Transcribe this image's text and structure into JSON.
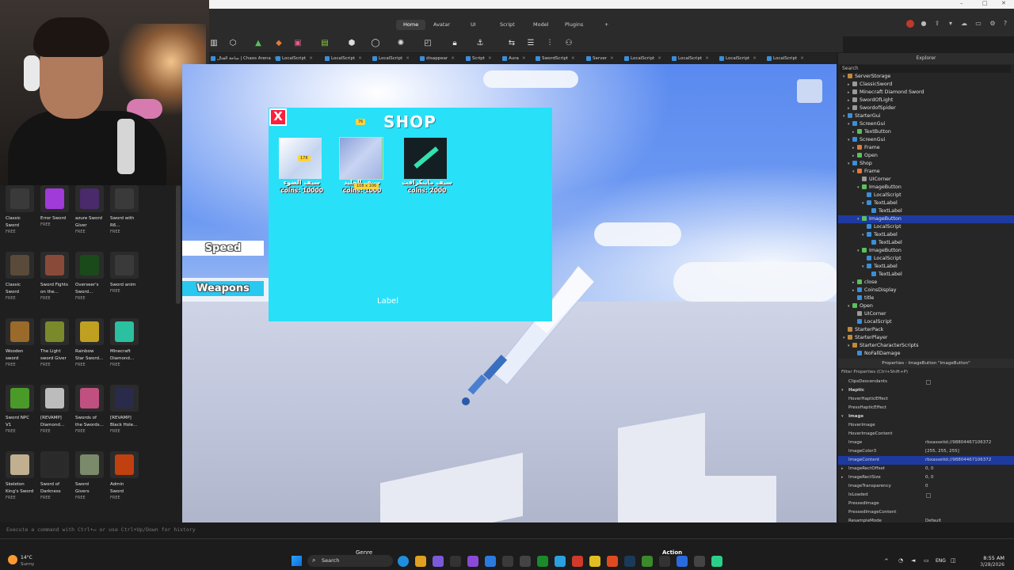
{
  "menu": {
    "tabs": [
      "Home",
      "Avatar",
      "UI",
      "Script",
      "Model",
      "Plugins"
    ],
    "plus": "+"
  },
  "script_tabs": [
    "ساحة القتال | Chaos Arena",
    "LocalScript",
    "LocalScript",
    "LocalScript",
    "disappear",
    "Script",
    "Aura",
    "SwordScript",
    "Server",
    "LocalScript",
    "LocalScript",
    "LocalScript",
    "LocalScript"
  ],
  "toolbox": {
    "items": [
      {
        "name": "Classic\nSword",
        "price": "FREE",
        "color": "#3a3a3a"
      },
      {
        "name": "Error Sword",
        "price": "FREE",
        "color": "#a03ad9"
      },
      {
        "name": "azure Sword\nGiver",
        "price": "FREE",
        "color": "#4a2a6a"
      },
      {
        "name": "Sword with\nR6...",
        "price": "FREE",
        "color": "#3a3a3a"
      },
      {
        "name": "Classic\nSword",
        "price": "FREE",
        "color": "#5a4a3a"
      },
      {
        "name": "Sword Fights\non the...",
        "price": "FREE",
        "color": "#8a4a3a"
      },
      {
        "name": "Overseer's\nSword...",
        "price": "FREE",
        "color": "#1a4a1a"
      },
      {
        "name": "Sword anim",
        "price": "FREE",
        "color": "#3a3a3a"
      },
      {
        "name": "Wooden\nsword",
        "price": "FREE",
        "color": "#9a6a2a"
      },
      {
        "name": "The Light\nsword Giver",
        "price": "FREE",
        "color": "#7a8a2a"
      },
      {
        "name": "Rainbow\nStar Sword...",
        "price": "FREE",
        "color": "#c0a020"
      },
      {
        "name": "Minecraft\nDiamond...",
        "price": "FREE",
        "color": "#2ac0a0"
      },
      {
        "name": "Sword NPC\nV1",
        "price": "FREE",
        "color": "#4a9a2a"
      },
      {
        "name": "[REVAMP]\nDiamond...",
        "price": "FREE",
        "color": "#bcbcbc"
      },
      {
        "name": "Swords of\nthe Swords...",
        "price": "FREE",
        "color": "#c05080"
      },
      {
        "name": "[REVAMP]\nBlack Hole...",
        "price": "FREE",
        "color": "#2a2a4a"
      },
      {
        "name": "Skeleton\nKing's Sword",
        "price": "FREE",
        "color": "#c0b090"
      },
      {
        "name": "Sword of\nDarkness",
        "price": "FREE",
        "color": "#2a2a2a"
      },
      {
        "name": "Sword\nGivers",
        "price": "FREE",
        "color": "#7a8a6a"
      },
      {
        "name": "Admin\nSword",
        "price": "FREE",
        "color": "#c04010"
      }
    ]
  },
  "viewport": {
    "speed_label": "Speed",
    "weapons_label": "Weapons",
    "shop": {
      "title": "SHOP",
      "close": "X",
      "label": "Label",
      "items": [
        {
          "arabic": "سيف الضوء",
          "price": "coins: 10000"
        },
        {
          "arabic": "سيف الجليد",
          "price": "coins: 1000"
        },
        {
          "arabic": "سيف ماينكرافت",
          "price": "coins: 2000"
        }
      ],
      "dim_top": "76",
      "dim_left": "178",
      "dim_size": "108 x 106"
    }
  },
  "explorer": {
    "title": "Explorer",
    "search": "Search",
    "rows": [
      {
        "text": "ServerStorage",
        "depth": 1,
        "tw": "▾",
        "color": "#c08a3a"
      },
      {
        "text": "ClassicSword",
        "depth": 2,
        "tw": "▸",
        "color": "#9a9a9a"
      },
      {
        "text": "Minecraft Diamond Sword",
        "depth": 2,
        "tw": "▸",
        "color": "#9a9a9a"
      },
      {
        "text": "SwordOfLight",
        "depth": 2,
        "tw": "▸",
        "color": "#9a9a9a"
      },
      {
        "text": "SwordofSpider",
        "depth": 2,
        "tw": "▸",
        "color": "#9a9a9a"
      },
      {
        "text": "StarterGui",
        "depth": 1,
        "tw": "▾",
        "color": "#3a8fd9"
      },
      {
        "text": "ScreenGui",
        "depth": 2,
        "tw": "▾",
        "color": "#3a8fd9"
      },
      {
        "text": "TextButton",
        "depth": 3,
        "tw": "▸",
        "color": "#5ac05a"
      },
      {
        "text": "ScreenGui",
        "depth": 2,
        "tw": "▾",
        "color": "#3a8fd9"
      },
      {
        "text": "Frame",
        "depth": 3,
        "tw": "▸",
        "color": "#e07a3a"
      },
      {
        "text": "Open",
        "depth": 3,
        "tw": "▸",
        "color": "#5ac05a"
      },
      {
        "text": "Shop",
        "depth": 2,
        "tw": "▾",
        "color": "#3a8fd9"
      },
      {
        "text": "Frame",
        "depth": 3,
        "tw": "▾",
        "color": "#e07a3a"
      },
      {
        "text": "UICorner",
        "depth": 4,
        "tw": "",
        "color": "#9a9a9a"
      },
      {
        "text": "ImageButton",
        "depth": 4,
        "tw": "▾",
        "color": "#5ac05a"
      },
      {
        "text": "LocalScript",
        "depth": 5,
        "tw": "",
        "color": "#3a8fd9"
      },
      {
        "text": "TextLabel",
        "depth": 5,
        "tw": "▾",
        "color": "#3a8fd9"
      },
      {
        "text": "TextLabel",
        "depth": 6,
        "tw": "",
        "color": "#3a8fd9"
      },
      {
        "text": "ImageButton",
        "depth": 4,
        "tw": "▾",
        "color": "#5ac05a",
        "sel": true
      },
      {
        "text": "LocalScript",
        "depth": 5,
        "tw": "",
        "color": "#3a8fd9"
      },
      {
        "text": "TextLabel",
        "depth": 5,
        "tw": "▾",
        "color": "#3a8fd9"
      },
      {
        "text": "TextLabel",
        "depth": 6,
        "tw": "",
        "color": "#3a8fd9"
      },
      {
        "text": "ImageButton",
        "depth": 4,
        "tw": "▾",
        "color": "#5ac05a"
      },
      {
        "text": "LocalScript",
        "depth": 5,
        "tw": "",
        "color": "#3a8fd9"
      },
      {
        "text": "TextLabel",
        "depth": 5,
        "tw": "▾",
        "color": "#3a8fd9"
      },
      {
        "text": "TextLabel",
        "depth": 6,
        "tw": "",
        "color": "#3a8fd9"
      },
      {
        "text": "close",
        "depth": 3,
        "tw": "▸",
        "color": "#5ac05a"
      },
      {
        "text": "CoinsDisplay",
        "depth": 3,
        "tw": "▸",
        "color": "#3a8fd9"
      },
      {
        "text": "title",
        "depth": 3,
        "tw": "",
        "color": "#3a8fd9"
      },
      {
        "text": "Open",
        "depth": 2,
        "tw": "▾",
        "color": "#5ac05a"
      },
      {
        "text": "UICorner",
        "depth": 3,
        "tw": "",
        "color": "#9a9a9a"
      },
      {
        "text": "LocalScript",
        "depth": 3,
        "tw": "",
        "color": "#3a8fd9"
      },
      {
        "text": "StarterPack",
        "depth": 1,
        "tw": "",
        "color": "#c08a3a"
      },
      {
        "text": "StarterPlayer",
        "depth": 1,
        "tw": "▾",
        "color": "#c08a3a"
      },
      {
        "text": "StarterCharacterScripts",
        "depth": 2,
        "tw": "▾",
        "color": "#c08a3a"
      },
      {
        "text": "NoFallDamage",
        "depth": 3,
        "tw": "",
        "color": "#3a8fd9"
      }
    ]
  },
  "properties": {
    "title": "Properties - ImageButton \"ImageButton\"",
    "filter": "Filter Properties (Ctrl+Shift+P)",
    "rows": [
      {
        "k": "ClipsDescendants",
        "v": "",
        "type": "cb"
      },
      {
        "k": "Haptic",
        "v": "",
        "type": "sec"
      },
      {
        "k": "HoverHapticEffect",
        "v": ""
      },
      {
        "k": "PressHapticEffect",
        "v": ""
      },
      {
        "k": "Image",
        "v": "",
        "type": "sec"
      },
      {
        "k": "HoverImage",
        "v": ""
      },
      {
        "k": "HoverImageContent",
        "v": ""
      },
      {
        "k": "Image",
        "v": "rbxassetid://98804467106372"
      },
      {
        "k": "ImageColor3",
        "v": "[255, 255, 255]"
      },
      {
        "k": "ImageContent",
        "v": "rbxassetid://98804467106372",
        "type": "hl"
      },
      {
        "k": "ImageRectOffset",
        "v": "0, 0",
        "tw": "▸"
      },
      {
        "k": "ImageRectSize",
        "v": "0, 0",
        "tw": "▸"
      },
      {
        "k": "ImageTransparency",
        "v": "0"
      },
      {
        "k": "IsLoaded",
        "v": "",
        "type": "cb"
      },
      {
        "k": "PressedImage",
        "v": ""
      },
      {
        "k": "PressedImageContent",
        "v": ""
      },
      {
        "k": "ResampleMode",
        "v": "Default"
      }
    ]
  },
  "command": {
    "placeholder": "Execute a command with Ctrl+↵ or use Ctrl+Up/Down for history"
  },
  "taskbar": {
    "weather_temp": "14°C",
    "weather_desc": "Sunny",
    "search": "Search",
    "genre": "Genre",
    "action": "Action",
    "lang": "ENG",
    "time": "8:55 AM",
    "date": "3/28/2026"
  }
}
